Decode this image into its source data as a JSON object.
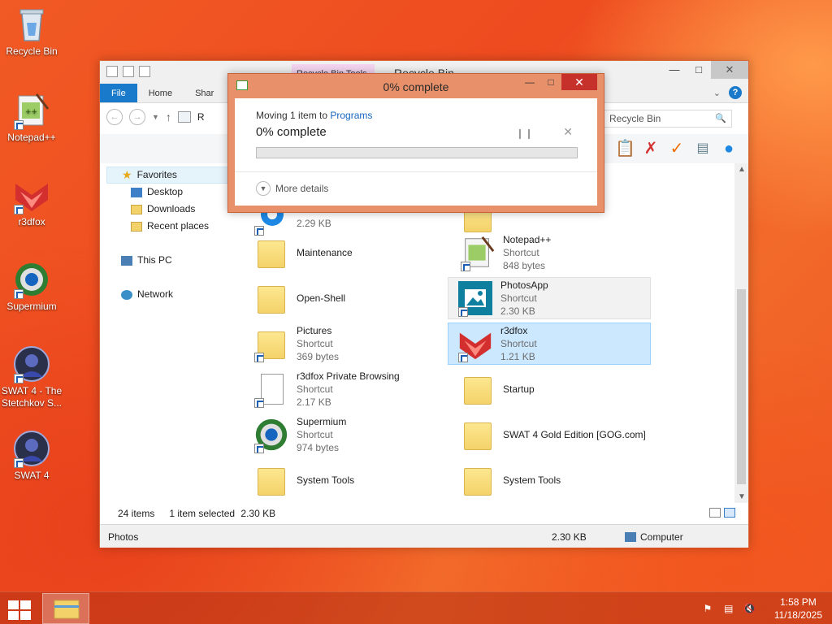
{
  "desktop": {
    "icons": [
      {
        "label": "Recycle Bin",
        "icon": "recycle-bin-icon"
      },
      {
        "label": "Notepad++",
        "icon": "notepad-plus-plus-icon"
      },
      {
        "label": "r3dfox",
        "icon": "r3dfox-icon"
      },
      {
        "label": "Supermium",
        "icon": "supermium-icon"
      },
      {
        "label": "SWAT 4 - The Stetchkov S...",
        "icon": "swat4-icon"
      },
      {
        "label": "SWAT 4",
        "icon": "swat4-icon"
      }
    ]
  },
  "explorer": {
    "title": "Recycle Bin",
    "context_tab": "Recycle Bin Tools",
    "ribbon_tabs": [
      "File",
      "Home",
      "Shar"
    ],
    "search_placeholder": "Recycle Bin",
    "address_fragment": "R",
    "nav": {
      "favorites_label": "Favorites",
      "favorites_items": [
        "Desktop",
        "Downloads",
        "Recent places"
      ],
      "this_pc": "This PC",
      "network": "Network"
    },
    "files": [
      {
        "name": "",
        "type": "",
        "size": "2.29 KB",
        "icon": "gear-shortcut-icon"
      },
      {
        "name": "",
        "type": "",
        "size": "",
        "icon": "folder-icon"
      },
      {
        "name": "Maintenance",
        "type": "",
        "size": "",
        "icon": "folder-icon"
      },
      {
        "name": "Notepad++",
        "type": "Shortcut",
        "size": "848 bytes",
        "icon": "notepad-plus-plus-icon"
      },
      {
        "name": "Open-Shell",
        "type": "",
        "size": "",
        "icon": "folder-icon"
      },
      {
        "name": "PhotosApp",
        "type": "Shortcut",
        "size": "2.30 KB",
        "icon": "photos-icon"
      },
      {
        "name": "Pictures",
        "type": "Shortcut",
        "size": "369 bytes",
        "icon": "folder-shortcut-icon"
      },
      {
        "name": "r3dfox",
        "type": "Shortcut",
        "size": "1.21 KB",
        "icon": "r3dfox-icon"
      },
      {
        "name": "r3dfox Private Browsing",
        "type": "Shortcut",
        "size": "2.17 KB",
        "icon": "document-shortcut-icon"
      },
      {
        "name": "Startup",
        "type": "",
        "size": "",
        "icon": "folder-icon"
      },
      {
        "name": "Supermium",
        "type": "Shortcut",
        "size": "974 bytes",
        "icon": "supermium-icon"
      },
      {
        "name": "SWAT 4 Gold Edition [GOG.com]",
        "type": "",
        "size": "",
        "icon": "folder-icon"
      },
      {
        "name": "System Tools",
        "type": "",
        "size": "",
        "icon": "folder-icon"
      },
      {
        "name": "System Tools",
        "type": "",
        "size": "",
        "icon": "folder-icon"
      }
    ],
    "status": {
      "items_count": "24 items",
      "selected": "1 item selected",
      "selected_size": "2.30 KB"
    },
    "details_bar": {
      "name": "Photos",
      "size": "2.30 KB",
      "location": "Computer"
    }
  },
  "dialog": {
    "title": "0% complete",
    "moving_text": "Moving 1 item to ",
    "destination": "Programs",
    "percent_text": "0% complete",
    "progress": 0,
    "more_details": "More details"
  },
  "taskbar": {
    "time": "1:58 PM",
    "date": "11/18/2025"
  },
  "colors": {
    "accent": "#1979ca",
    "dialog_frame": "#e8906a",
    "close_red": "#c7312c",
    "selection": "#cce8ff"
  }
}
